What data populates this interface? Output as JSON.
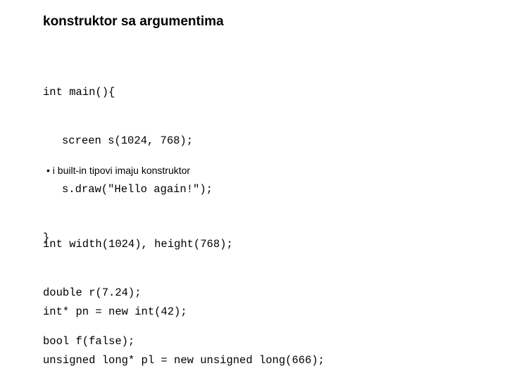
{
  "slide": {
    "title": "konstruktor sa argumentima",
    "code_block_1": [
      "int main(){",
      "screen s(1024, 768);",
      "s.draw(\"Hello again!\");",
      "}"
    ],
    "bullet": {
      "symbol": "•",
      "text": "i built-in tipovi imaju konstruktor"
    },
    "code_block_2": [
      "int width(1024), height(768);",
      "double r(7.24);",
      "bool f(false);"
    ],
    "code_block_3": [
      "int* pn = new int(42);",
      "unsigned long* pl = new unsigned long(666);"
    ]
  }
}
